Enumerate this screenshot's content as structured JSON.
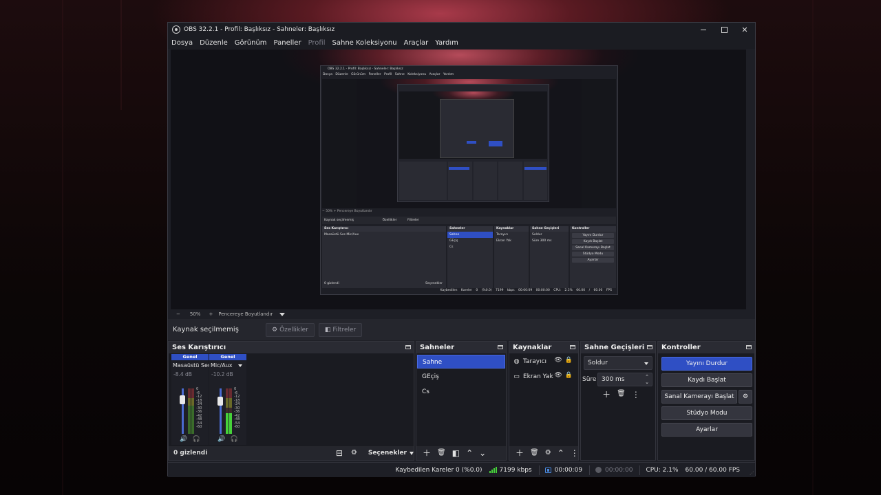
{
  "window": {
    "title": "OBS 32.2.1 - Profil: Başlıksız - Sahneler: Başlıksız",
    "minimize_symbol": "",
    "close_symbol": "✕"
  },
  "menu": [
    "Dosya",
    "Düzenle",
    "Görünüm",
    "Paneller",
    "Profil",
    "Sahne Koleksiyonu",
    "Araçlar",
    "Yardım"
  ],
  "preview": {
    "zoom_minus": "−",
    "zoom_value": "50%",
    "zoom_plus": "+",
    "zoom_mode": "Pencereye Boyutlandır"
  },
  "source_bar": {
    "label": "Kaynak seçilmemiş",
    "properties_label": "Özellikler",
    "filters_label": "Filtreler"
  },
  "mixer": {
    "title": "Ses Karıştırıcı",
    "strips": [
      {
        "tag": "Genel",
        "name": "Masaüstü Ses",
        "db": "-8.4 dB",
        "level": 0.62,
        "fader": 0.76
      },
      {
        "tag": "Genel",
        "name": "Mic/Aux",
        "db": "-10.2 dB",
        "level": 0.45,
        "fader": 0.72
      }
    ],
    "scale": [
      "0",
      "-6",
      "-12",
      "-18",
      "-24",
      "-30",
      "-36",
      "-42",
      "-48",
      "-54",
      "-60"
    ],
    "hidden_label": "0 gizlendi",
    "options_label": "Seçenekler"
  },
  "scenes": {
    "title": "Sahneler",
    "items": [
      "Sahne",
      "GEçiş",
      "Cs"
    ],
    "selected": 0
  },
  "sources": {
    "title": "Kaynaklar",
    "items": [
      {
        "name": "Tarayıcı",
        "icon": "globe-icon"
      },
      {
        "name": "Ekran Yak",
        "icon": "monitor-icon"
      }
    ]
  },
  "transitions": {
    "title": "Sahne Geçişleri",
    "selected": "Soldur",
    "duration_label": "Süre",
    "duration_value": "300 ms"
  },
  "controls": {
    "title": "Kontroller",
    "stop_stream": "Yayını Durdur",
    "start_record": "Kaydı Başlat",
    "virtual_cam": "Sanal Kamerayı Başlat",
    "studio_mode": "Stüdyo Modu",
    "settings": "Ayarlar"
  },
  "status": {
    "dropped": "Kaybedilen Kareler 0 (%0.0)",
    "bitrate": "7199 kbps",
    "stream_time": "00:00:09",
    "record_time": "00:00:00",
    "cpu": "CPU: 2.1%",
    "fps": "60.00 / 60.00 FPS"
  },
  "nested": {
    "title": "OBS 32.2.1 - Profil: Başlıksız - Sahneler: Başlıksız",
    "menu": "Dosya Düzenle Görünüm Paneller Profil Sahne Koleksiyonu Araçlar Yardım",
    "zoom": "−  50%  +  Pencereye Boyutlandır",
    "source_label": "Kaynak seçilmemiş",
    "props": "Özellikler",
    "filters": "Filtreler",
    "mixer_title": "Ses Karıştırıcı",
    "scenes_title": "Sahneler",
    "sources_title": "Kaynaklar",
    "transitions_title": "Sahne Geçişleri",
    "controls_title": "Kontroller",
    "scene_items": [
      "Sahne",
      "GEçiş",
      "Cs"
    ],
    "source_items": [
      "Tarayıcı",
      "Ekran Yak"
    ],
    "trans_value": "Soldur",
    "trans_dur": "300 ms",
    "trans_label": "Süre",
    "btns": [
      "Yayını Durdur",
      "Kaydı Başlat",
      "Sanal Kamerayı Başlat",
      "Stüdyo Modu",
      "Ayarlar"
    ],
    "hidden": "0 gizlendi",
    "options": "Seçenekler",
    "status": "Kaybedilen Kareler 0 (%0.0)  7199 kbps  00:00:09  00:00:00  CPU: 2.1%  60.00 / 60.00 FPS",
    "strip_names": [
      "Masaüstü Ses",
      "Mic/Aux"
    ],
    "strip_tag": "Genel",
    "strip_db": [
      "-8.4 dB",
      "-10.2 dB"
    ]
  }
}
